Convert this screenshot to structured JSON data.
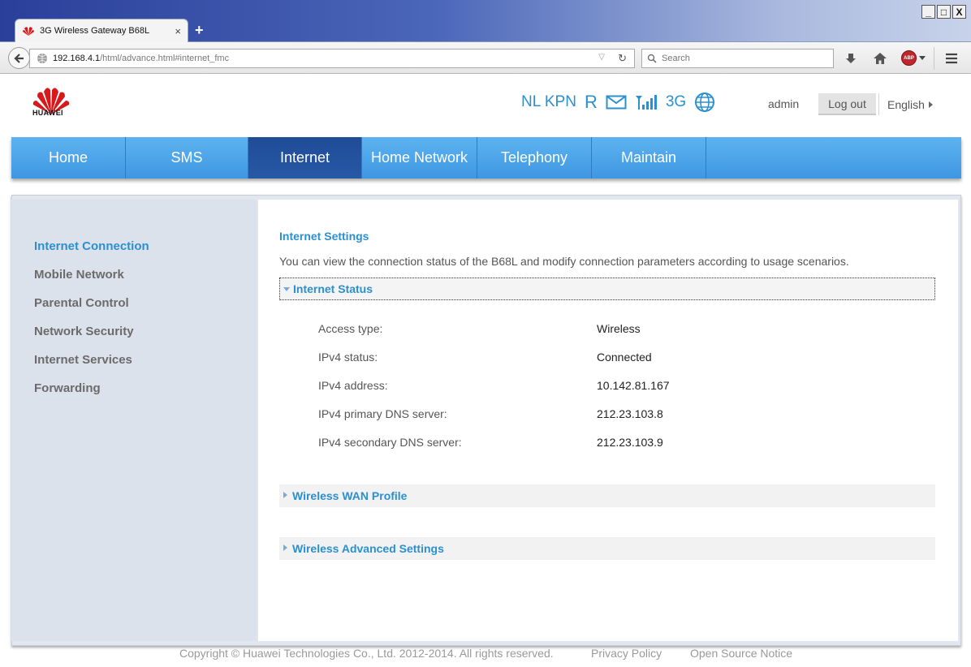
{
  "browser": {
    "tab_title": "3G Wireless Gateway B68L",
    "tab_close": "×",
    "new_tab": "+",
    "url_host": "192.168.4.1",
    "url_path": "/html/advance.html#internet_fmc",
    "search_placeholder": "Search",
    "abp_label": "ABP",
    "window_controls": [
      "_",
      "□",
      "X"
    ]
  },
  "header": {
    "logo_text": "HUAWEI",
    "carrier": "NL KPN",
    "roaming": "R",
    "network_type": "3G",
    "username": "admin",
    "logout_label": "Log out",
    "language": "English",
    "brand_color": "#2b8fd0"
  },
  "menu": [
    {
      "label": "Home",
      "active": false
    },
    {
      "label": "SMS",
      "active": false
    },
    {
      "label": "Internet",
      "active": true
    },
    {
      "label": "Home Network",
      "active": false
    },
    {
      "label": "Telephony",
      "active": false
    },
    {
      "label": "Maintain",
      "active": false
    }
  ],
  "sidebar": [
    {
      "label": "Internet Connection",
      "active": true
    },
    {
      "label": "Mobile Network",
      "active": false
    },
    {
      "label": "Parental Control",
      "active": false
    },
    {
      "label": "Network Security",
      "active": false
    },
    {
      "label": "Internet Services",
      "active": false
    },
    {
      "label": "Forwarding",
      "active": false
    }
  ],
  "main": {
    "title": "Internet Settings",
    "description": "You can view the connection status of the B68L and modify connection parameters according to usage scenarios.",
    "status_section": {
      "title": "Internet Status",
      "rows": [
        {
          "label": "Access type:",
          "value": "Wireless"
        },
        {
          "label": "IPv4 status:",
          "value": "Connected"
        },
        {
          "label": "IPv4 address:",
          "value": "10.142.81.167"
        },
        {
          "label": "IPv4 primary DNS server:",
          "value": "212.23.103.8"
        },
        {
          "label": "IPv4 secondary DNS server:",
          "value": "212.23.103.9"
        }
      ]
    },
    "collapsed_sections": [
      {
        "title": "Wireless WAN Profile"
      },
      {
        "title": "Wireless Advanced Settings"
      }
    ]
  },
  "footer": {
    "copyright": "Copyright © Huawei Technologies Co., Ltd. 2012-2014. All rights reserved.",
    "privacy": "Privacy Policy",
    "open_source": "Open Source Notice"
  }
}
